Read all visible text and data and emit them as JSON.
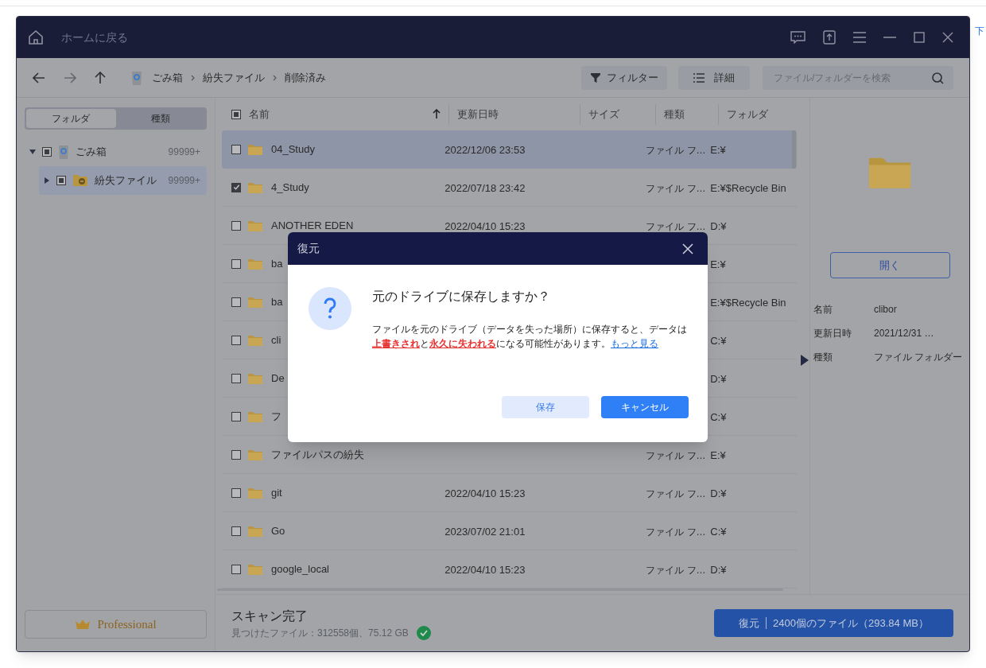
{
  "background_page": {
    "link_text": "下"
  },
  "window": {
    "title": "ホームに戻る"
  },
  "toolbar": {
    "breadcrumb": [
      "ごみ箱",
      "紛失ファイル",
      "削除済み"
    ],
    "filter_button": "フィルター",
    "details_button": "詳細",
    "search": {
      "placeholder": "ファイル/フォルダーを検索"
    }
  },
  "sidebar": {
    "tabs": [
      {
        "label": "フォルダ",
        "selected": true
      },
      {
        "label": "種類",
        "selected": false
      }
    ],
    "tree": [
      {
        "label": "ごみ箱",
        "count": "99999+",
        "kind": "recycle",
        "partially_checked": true,
        "expanded": true,
        "selected": false,
        "children": [
          {
            "label": "紛失ファイル",
            "count": "99999+",
            "kind": "lost",
            "partially_checked": true,
            "expanded": false,
            "selected": true
          }
        ]
      }
    ],
    "edition_button": "Professional"
  },
  "table": {
    "select_all_partial": true,
    "columns": [
      {
        "label": "名前",
        "sorted": true
      },
      {
        "label": "更新日時",
        "sorted": false
      },
      {
        "label": "サイズ",
        "sorted": false
      },
      {
        "label": "種類",
        "sorted": false
      },
      {
        "label": "フォルダ",
        "sorted": false
      }
    ],
    "rows": [
      {
        "name": "04_Study",
        "modified": "2022/12/06 23:53",
        "type": "ファイル フ…",
        "folder": "E:¥",
        "checked": false,
        "selected": true
      },
      {
        "name": "4_Study",
        "modified": "2022/07/18 23:42",
        "type": "ファイル フ…",
        "folder": "E:¥$Recycle Bin",
        "checked": true,
        "selected": false
      },
      {
        "name": "ANOTHER EDEN",
        "modified": "2022/04/10 15:23",
        "type": "ファイル フ…",
        "folder": "D:¥",
        "checked": false,
        "selected": false
      },
      {
        "name": "ba",
        "folder": "E:¥",
        "checked": false,
        "selected": false
      },
      {
        "name": "ba",
        "folder": "E:¥$Recycle Bin",
        "checked": false,
        "selected": false
      },
      {
        "name": "cli",
        "folder": "C:¥",
        "checked": false,
        "selected": false
      },
      {
        "name": "De",
        "folder": "D:¥",
        "checked": false,
        "selected": false
      },
      {
        "name": "フ",
        "folder": "C:¥",
        "checked": false,
        "selected": false
      },
      {
        "name": "ファイルパスの紛失",
        "type": "ファイル フ…",
        "folder": "E:¥",
        "checked": false,
        "selected": false
      },
      {
        "name": "git",
        "modified": "2022/04/10 15:23",
        "type": "ファイル フ…",
        "folder": "D:¥",
        "checked": false,
        "selected": false
      },
      {
        "name": "Go",
        "modified": "2023/07/02 21:01",
        "type": "ファイル フ…",
        "folder": "C:¥",
        "checked": false,
        "selected": false
      },
      {
        "name": "google_local",
        "modified": "2022/04/10 15:23",
        "type": "ファイル フ…",
        "folder": "D:¥",
        "checked": false,
        "selected": false
      }
    ]
  },
  "details": {
    "open_button": "開く",
    "fields": [
      {
        "label": "名前",
        "value": "clibor"
      },
      {
        "label": "更新日時",
        "value": "2021/12/31 …"
      },
      {
        "label": "種類",
        "value": "ファイル フォルダー"
      }
    ]
  },
  "status": {
    "title": "スキャン完了",
    "summary": "見つけたファイル：312558個、75.12 GB",
    "done": true,
    "recover_button": "復元",
    "recover_detail": "2400個のファイル（293.84 MB）"
  },
  "dialog": {
    "title": "復元",
    "heading": "元のドライブに保存しますか？",
    "message": [
      {
        "kind": "plain",
        "text": "ファイルを元のドライブ（データを失った場所）に保存すると、データは"
      },
      {
        "kind": "warning",
        "text": "上書きされ"
      },
      {
        "kind": "plain",
        "text": "と"
      },
      {
        "kind": "warning",
        "text": "永久に失われる"
      },
      {
        "kind": "plain",
        "text": "になる可能性があります。"
      },
      {
        "kind": "link",
        "text": "もっと見る"
      }
    ],
    "buttons": [
      {
        "label": "保存",
        "kind": "secondary"
      },
      {
        "label": "キャンセル",
        "kind": "primary"
      }
    ]
  }
}
